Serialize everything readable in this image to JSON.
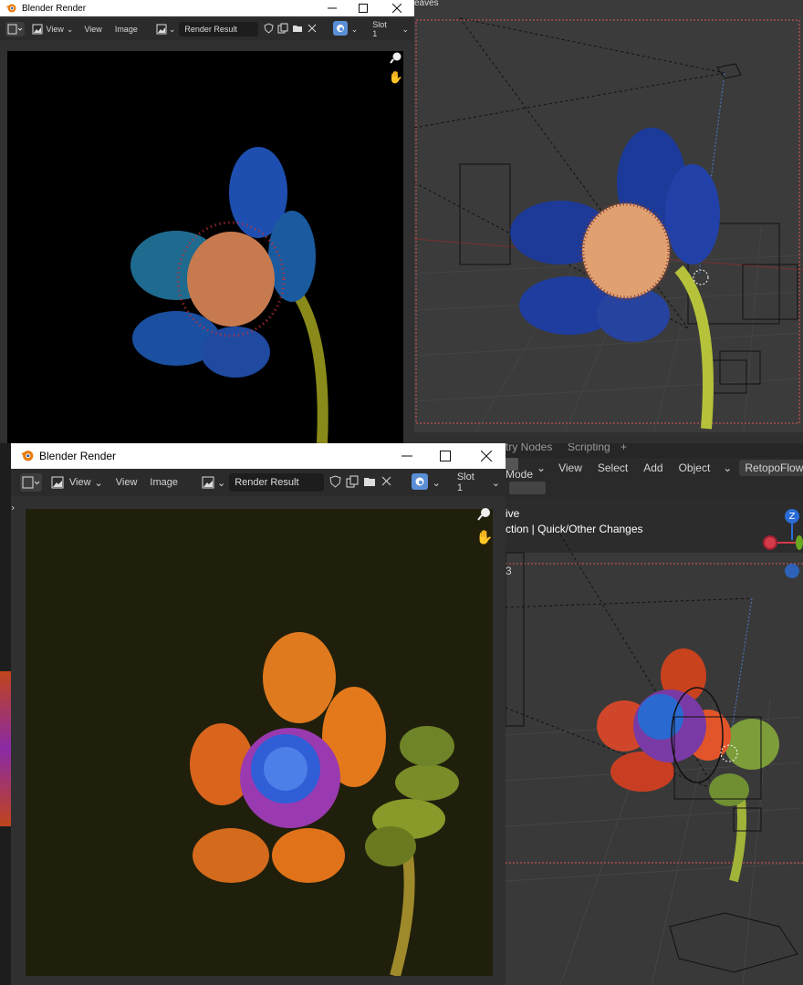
{
  "top_window": {
    "title": "Blender Render",
    "menu": {
      "view_dropdown": "View",
      "view": "View",
      "image": "Image"
    },
    "image_name": "Render Result",
    "slot": "Slot 1"
  },
  "top_viewport": {
    "label": "eaves"
  },
  "bottom_window": {
    "title": "Blender Render",
    "menu": {
      "view_dropdown": "View",
      "view": "View",
      "image": "Image"
    },
    "image_name": "Render Result",
    "slot": "Slot 1"
  },
  "bottom_viewport": {
    "workspace_tabs": [
      "try Nodes",
      "Scripting",
      "+"
    ],
    "header": {
      "mode": "ct Mode",
      "view": "View",
      "select": "Select",
      "add": "Add",
      "object": "Object",
      "addon": "RetopoFlow"
    },
    "overlay_line1": "ive",
    "overlay_line2": "ction | Quick/Other Changes",
    "overlay_line3": "3",
    "gizmo": {
      "z_label": "Z"
    }
  },
  "colors": {
    "blender_orange": "#e87d0d",
    "gizmo_z": "#2b6dd8",
    "gizmo_x": "#d33a4a",
    "gizmo_y": "#6aa71f",
    "slot_icon": "#5a8fd6"
  },
  "icons": [
    "blender-logo-icon",
    "minimize-icon",
    "maximize-icon",
    "close-icon",
    "editor-type-icon",
    "image-icon",
    "shield-icon",
    "duplicate-icon",
    "folder-icon",
    "x-icon",
    "render-slot-icon",
    "zoom-icon",
    "hand-icon",
    "chevron-down-icon"
  ]
}
